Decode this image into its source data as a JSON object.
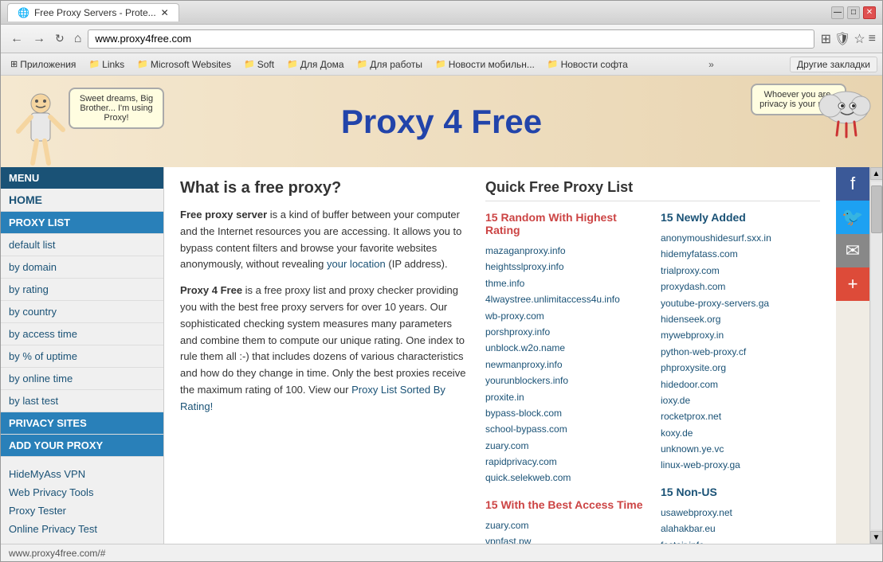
{
  "browser": {
    "tab_title": "Free Proxy Servers - Prote...",
    "url": "www.proxy4free.com",
    "status_bar_url": "www.proxy4free.com/#"
  },
  "bookmarks": {
    "items": [
      {
        "label": "Приложения",
        "icon": "⊞"
      },
      {
        "label": "Links",
        "icon": "📁"
      },
      {
        "label": "Microsoft Websites",
        "icon": "📁"
      },
      {
        "label": "Soft",
        "icon": "📁"
      },
      {
        "label": "Для Дома",
        "icon": "📁"
      },
      {
        "label": "Для работы",
        "icon": "📁"
      },
      {
        "label": "Новости мобильн...",
        "icon": "📁"
      },
      {
        "label": "Новости софта",
        "icon": "📁"
      }
    ],
    "more_label": "»",
    "other_label": "Другие закладки"
  },
  "site": {
    "header": {
      "title": "Proxy 4 Free",
      "speech_left": "Sweet dreams, Big Brother... I'm using Proxy!",
      "speech_right": "Whoever you are, privacy is your right!"
    },
    "sidebar": {
      "menu_label": "MENU",
      "items": [
        {
          "label": "HOME",
          "type": "main"
        },
        {
          "label": "PROXY LIST",
          "type": "section"
        },
        {
          "label": "default list",
          "type": "sub"
        },
        {
          "label": "by domain",
          "type": "sub"
        },
        {
          "label": "by rating",
          "type": "sub"
        },
        {
          "label": "by country",
          "type": "sub"
        },
        {
          "label": "by access time",
          "type": "sub"
        },
        {
          "label": "by % of uptime",
          "type": "sub"
        },
        {
          "label": "by online time",
          "type": "sub"
        },
        {
          "label": "by last test",
          "type": "sub"
        },
        {
          "label": "PRIVACY SITES",
          "type": "section"
        },
        {
          "label": "ADD YOUR PROXY",
          "type": "section"
        }
      ],
      "footer_links": [
        {
          "label": "HideMyAss VPN"
        },
        {
          "label": "Web Privacy Tools"
        },
        {
          "label": "Proxy Tester"
        },
        {
          "label": "Online Privacy Test"
        }
      ]
    },
    "main": {
      "what_is_proxy_title": "What is a free proxy?",
      "paragraph1_parts": {
        "bold": "Free proxy server",
        "rest": " is a kind of buffer between your computer and the Internet resources you are accessing. It allows you to bypass content filters and browse your favorite websites anonymously, without revealing ",
        "link": "your location",
        "rest2": " (IP address)."
      },
      "paragraph2_parts": {
        "bold": "Proxy 4 Free",
        "rest": " is a free proxy list and proxy checker providing you with the best free proxy servers for over 10 years. Our sophisticated checking system measures many parameters and combine them to compute our unique rating. One index to rule them all :-) that includes dozens of various characteristics and how do they change in time. Only the best proxies receive the maximum rating of 100. View our ",
        "link": "Proxy List Sorted By Rating!",
        "rest2": ""
      }
    },
    "quick_proxy": {
      "title": "Quick Free Proxy List",
      "section1_title": "15 Random With Highest Rating",
      "section1_links": [
        "mazaganproxy.info",
        "heightsslproxy.info",
        "thme.info",
        "4lwaystree.unlimitaccess4u.info",
        "wb-proxy.com",
        "porshproxy.info",
        "unblock.w2o.name",
        "newmanproxy.info",
        "yourunblockers.info",
        "proxite.in",
        "bypass-block.com",
        "school-bypass.com",
        "zuary.com",
        "rapidprivacy.com",
        "quick.selekweb.com"
      ],
      "section2_title": "15 Newly Added",
      "section2_links": [
        "anonymoushidesurf.sxx.in",
        "hidemyfatass.com",
        "trialproxy.com",
        "proxydash.com",
        "youtube-proxy-servers.ga",
        "hidenseek.org",
        "mywebproxy.in",
        "python-web-proxy.cf",
        "phproxysite.org",
        "hidedoor.com",
        "ioxy.de",
        "rocketprox.net",
        "koxy.de",
        "unknown.ye.vc",
        "linux-web-proxy.ga"
      ],
      "section3_title": "15 With the Best Access Time",
      "section3_links": [
        "zuary.com",
        "vpnfast.pw"
      ],
      "section4_title": "15 Non-US",
      "section4_links": [
        "usawebproxy.net",
        "alahakbar.eu",
        "fastair.info"
      ]
    }
  }
}
